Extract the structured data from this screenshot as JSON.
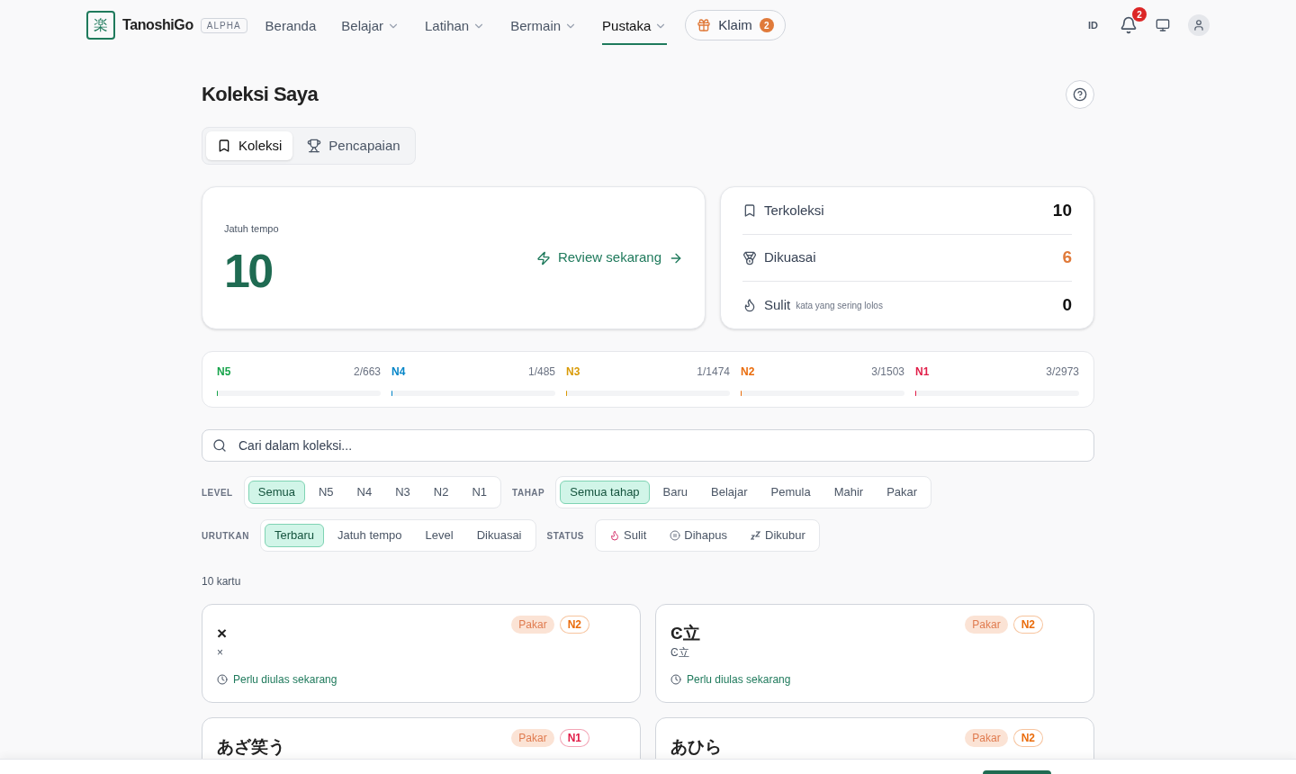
{
  "brand": {
    "name": "TanoshiGo",
    "logo_char": "楽",
    "tag": "ALPHA"
  },
  "nav": [
    {
      "label": "Beranda",
      "dropdown": false,
      "selected": false
    },
    {
      "label": "Belajar",
      "dropdown": true,
      "selected": false
    },
    {
      "label": "Latihan",
      "dropdown": true,
      "selected": false
    },
    {
      "label": "Bermain",
      "dropdown": true,
      "selected": false
    },
    {
      "label": "Pustaka",
      "dropdown": true,
      "selected": true
    }
  ],
  "claim": {
    "label": "Klaim",
    "count": "2"
  },
  "header_right": {
    "lang": "ID",
    "notifications": "2"
  },
  "page_title": "Koleksi Saya",
  "tabs": [
    {
      "label": "Koleksi",
      "kind": "bookmark",
      "selected": true
    },
    {
      "label": "Pencapaian",
      "kind": "trophy",
      "selected": false
    }
  ],
  "due": {
    "label": "Jatuh tempo",
    "count": "10",
    "action": "Review sekarang"
  },
  "stats": [
    {
      "kind": "bookmark",
      "label": "Terkoleksi",
      "value": "10",
      "color": "#111111"
    },
    {
      "kind": "medal",
      "label": "Dikuasai",
      "value": "6",
      "color": "#e07a3a"
    },
    {
      "kind": "flame",
      "label": "Sulit",
      "note": "kata yang sering lolos",
      "value": "0",
      "color": "#111111"
    }
  ],
  "levels": [
    {
      "name": "N5",
      "count": "2/663",
      "level": 0.003,
      "color": "#16a34a"
    },
    {
      "name": "N4",
      "count": "1/485",
      "level": 0.002,
      "color": "#0284c7"
    },
    {
      "name": "N3",
      "count": "1/1474",
      "level": 0.001,
      "color": "#d99a06"
    },
    {
      "name": "N2",
      "count": "3/1503",
      "level": 0.002,
      "color": "#ea6c0c"
    },
    {
      "name": "N1",
      "count": "3/2973",
      "level": 0.001,
      "color": "#e11d48"
    }
  ],
  "search": {
    "placeholder": "Cari dalam koleksi..."
  },
  "filter_rows": [
    [
      {
        "label": "LEVEL",
        "options": [
          {
            "label": "Semua",
            "selected": true
          },
          {
            "label": "N5",
            "selected": false
          },
          {
            "label": "N4",
            "selected": false
          },
          {
            "label": "N3",
            "selected": false
          },
          {
            "label": "N2",
            "selected": false
          },
          {
            "label": "N1",
            "selected": false
          }
        ]
      },
      {
        "label": "TAHAP",
        "options": [
          {
            "label": "Semua tahap",
            "selected": true
          },
          {
            "label": "Baru",
            "selected": false
          },
          {
            "label": "Belajar",
            "selected": false
          },
          {
            "label": "Pemula",
            "selected": false
          },
          {
            "label": "Mahir",
            "selected": false
          },
          {
            "label": "Pakar",
            "selected": false
          }
        ]
      }
    ],
    [
      {
        "label": "URUTKAN",
        "options": [
          {
            "label": "Terbaru",
            "selected": true
          },
          {
            "label": "Jatuh tempo",
            "selected": false
          },
          {
            "label": "Level",
            "selected": false
          },
          {
            "label": "Dikuasai",
            "selected": false
          }
        ]
      },
      {
        "label": "STATUS",
        "options": [
          {
            "label": "Sulit",
            "kind": "flame",
            "selected": false
          },
          {
            "label": "Dihapus",
            "kind": "pause",
            "selected": false
          },
          {
            "label": "Dikubur",
            "kind": "sleep",
            "selected": false
          }
        ]
      }
    ]
  ],
  "count_label": "10 kartu",
  "cards": [
    {
      "word": "×",
      "reading": "×",
      "stage": "Pakar",
      "level": "N2",
      "color": "#ea6c0c",
      "due": "Perlu diulas sekarang"
    },
    {
      "word": "Ͼ立",
      "reading": "Ͼ立",
      "stage": "Pakar",
      "level": "N2",
      "color": "#ea6c0c",
      "due": "Perlu diulas sekarang"
    },
    {
      "word": "あざ笑う",
      "stage": "Pakar",
      "level": "N1",
      "color": "#e11d48"
    },
    {
      "word": "あひら",
      "stage": "Pakar",
      "level": "N2",
      "color": "#ea6c0c"
    }
  ]
}
